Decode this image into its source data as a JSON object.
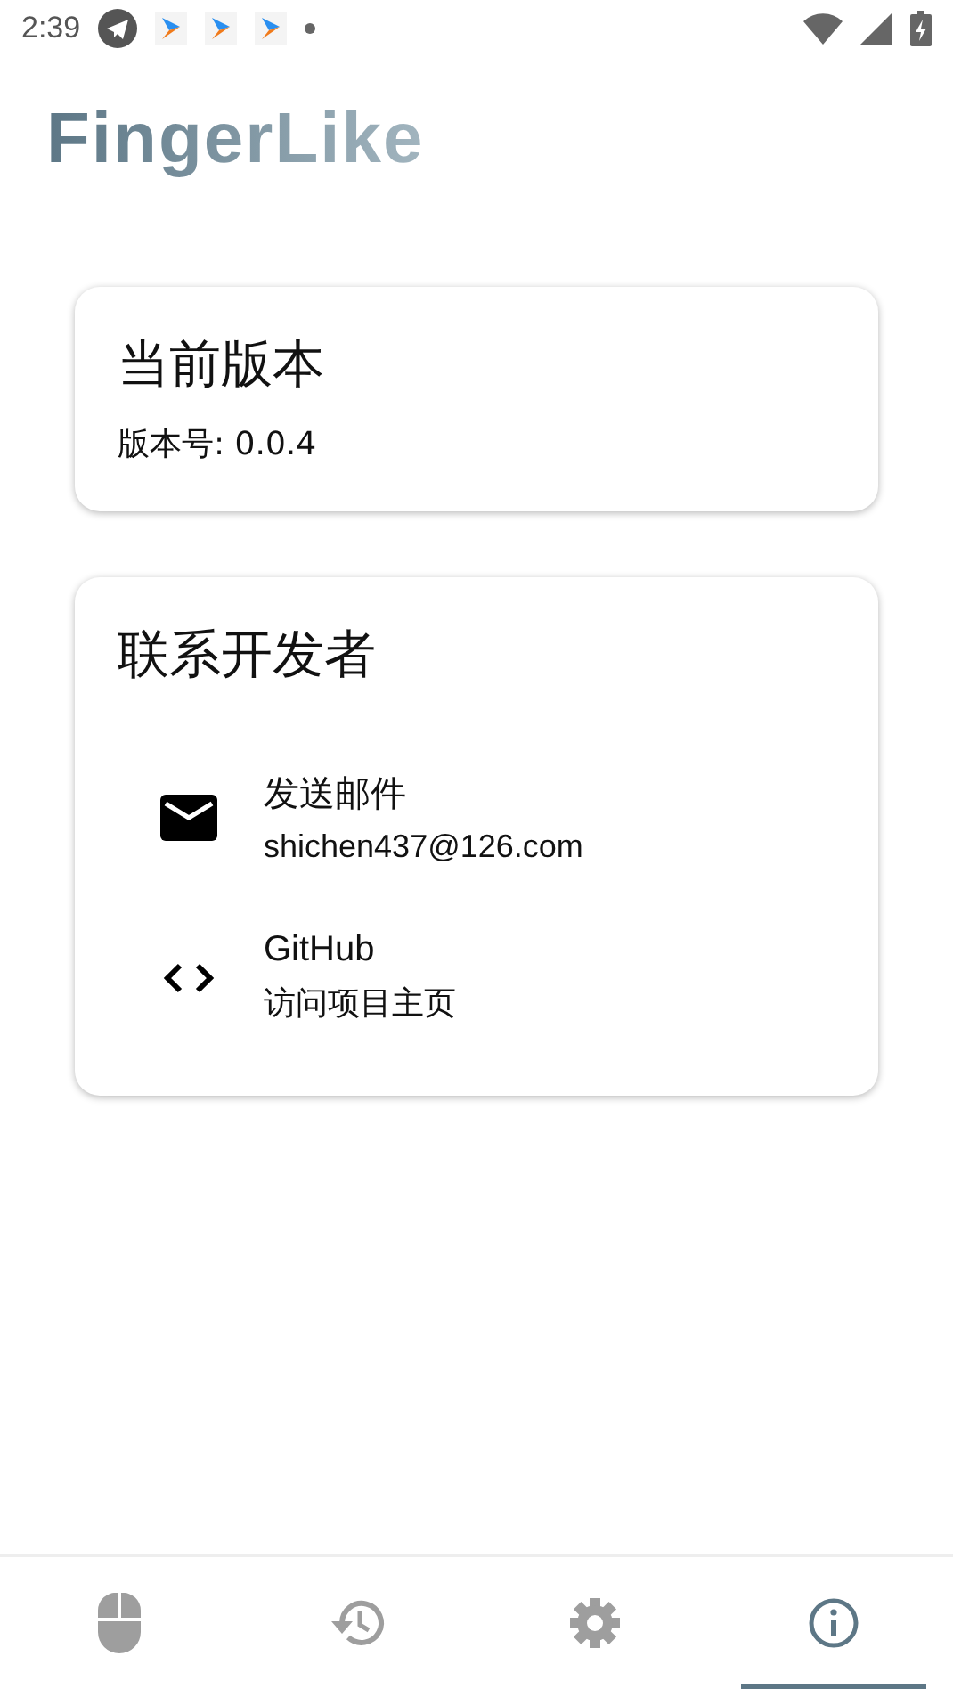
{
  "status_bar": {
    "time": "2:39"
  },
  "app_title": "FingerLike",
  "version_card": {
    "title": "当前版本",
    "version": "版本号: 0.0.4"
  },
  "contact_card": {
    "title": "联系开发者",
    "items": [
      {
        "kind": "email",
        "title": "发送邮件",
        "subtitle": "shichen437@126.com"
      },
      {
        "kind": "code",
        "title": "GitHub",
        "subtitle": "访问项目主页"
      }
    ]
  },
  "bottom_nav": [
    {
      "kind": "mouse",
      "selected": false
    },
    {
      "kind": "history",
      "selected": false
    },
    {
      "kind": "settings",
      "selected": false
    },
    {
      "kind": "info",
      "selected": true
    }
  ]
}
